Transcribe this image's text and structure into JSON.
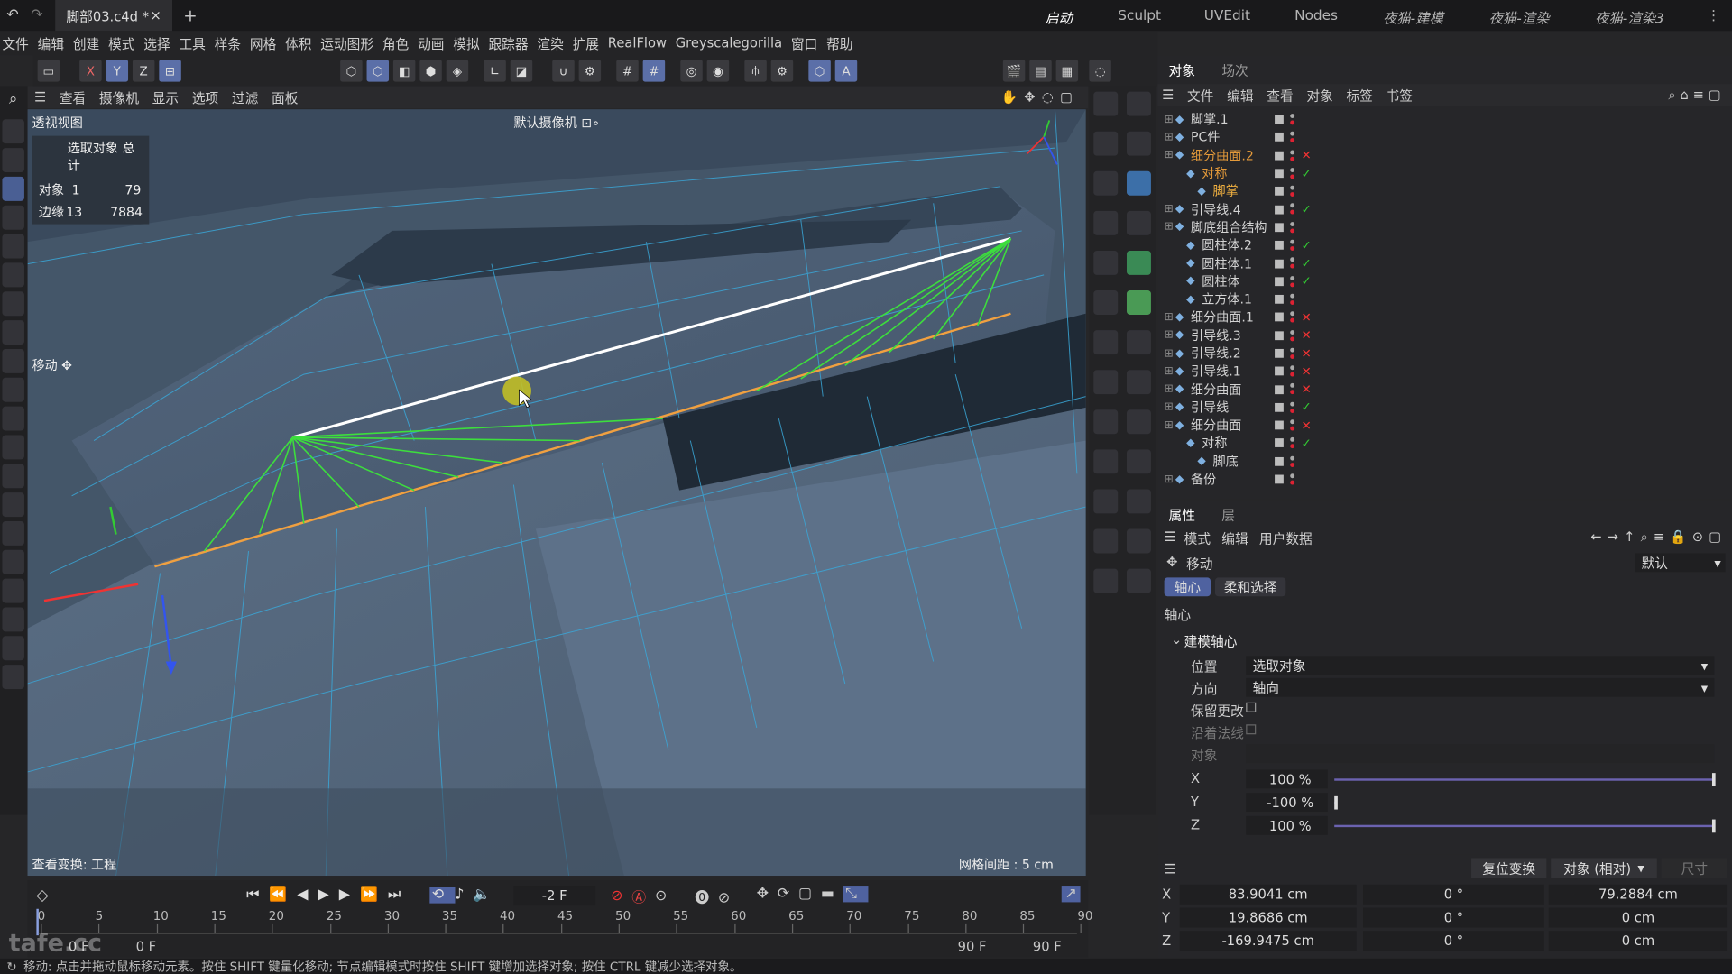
{
  "titlebar": {
    "doc_tab": "脚部03.c4d *",
    "close": "×",
    "add": "+",
    "workspaces": [
      "启动",
      "Sculpt",
      "UVEdit",
      "Nodes",
      "夜猫-建模",
      "夜猫-渲染",
      "夜猫-渲染3"
    ]
  },
  "menubar": [
    "文件",
    "编辑",
    "创建",
    "模式",
    "选择",
    "工具",
    "样条",
    "网格",
    "体积",
    "运动图形",
    "角色",
    "动画",
    "模拟",
    "跟踪器",
    "渲染",
    "扩展",
    "RealFlow",
    "Greyscalegorilla",
    "窗口",
    "帮助"
  ],
  "viewport_menu": [
    "查看",
    "摄像机",
    "显示",
    "选项",
    "过滤",
    "面板"
  ],
  "viewport": {
    "name": "透视视图",
    "camera": "默认摄像机 ⊡∘",
    "stats_header": "选取对象 总计",
    "stats": [
      {
        "label": "对象",
        "sel": "1",
        "total": "79"
      },
      {
        "label": "边缘",
        "sel": "13",
        "total": "7884"
      }
    ],
    "tool": "移动 ✥",
    "view_transform": "查看变换: 工程",
    "grid_spacing": "网格间距 : 5 cm"
  },
  "objpanel": {
    "tabs": [
      "对象",
      "场次"
    ],
    "menu": [
      "文件",
      "编辑",
      "查看",
      "对象",
      "标签",
      "书签"
    ],
    "items": [
      {
        "name": "脚掌.1",
        "indent": 0,
        "color": "#d3d3d3",
        "status": ""
      },
      {
        "name": "PC件",
        "indent": 0,
        "color": "#d3d3d3",
        "status": ""
      },
      {
        "name": "细分曲面.2",
        "indent": 0,
        "color": "#e49a3a",
        "status": "✕"
      },
      {
        "name": "对称",
        "indent": 1,
        "color": "#e49a3a",
        "status": "✓"
      },
      {
        "name": "脚掌",
        "indent": 2,
        "color": "#f0b040",
        "status": ""
      },
      {
        "name": "引导线.4",
        "indent": 0,
        "color": "#d3d3d3",
        "status": "✓"
      },
      {
        "name": "脚底组合结构",
        "indent": 0,
        "color": "#d3d3d3",
        "status": ""
      },
      {
        "name": "圆柱体.2",
        "indent": 1,
        "color": "#d3d3d3",
        "status": "✓"
      },
      {
        "name": "圆柱体.1",
        "indent": 1,
        "color": "#d3d3d3",
        "status": "✓"
      },
      {
        "name": "圆柱体",
        "indent": 1,
        "color": "#d3d3d3",
        "status": "✓"
      },
      {
        "name": "立方体.1",
        "indent": 1,
        "color": "#d3d3d3",
        "status": ""
      },
      {
        "name": "细分曲面.1",
        "indent": 0,
        "color": "#d3d3d3",
        "status": "✕"
      },
      {
        "name": "引导线.3",
        "indent": 0,
        "color": "#d3d3d3",
        "status": "✕"
      },
      {
        "name": "引导线.2",
        "indent": 0,
        "color": "#d3d3d3",
        "status": "✕"
      },
      {
        "name": "引导线.1",
        "indent": 0,
        "color": "#d3d3d3",
        "status": "✕"
      },
      {
        "name": "细分曲面",
        "indent": 0,
        "color": "#d3d3d3",
        "status": "✕"
      },
      {
        "name": "引导线",
        "indent": 0,
        "color": "#d3d3d3",
        "status": "✓"
      },
      {
        "name": "细分曲面",
        "indent": 0,
        "color": "#d3d3d3",
        "status": "✕"
      },
      {
        "name": "对称",
        "indent": 1,
        "color": "#d3d3d3",
        "status": "✓"
      },
      {
        "name": "脚底",
        "indent": 2,
        "color": "#d3d3d3",
        "status": ""
      },
      {
        "name": "备份",
        "indent": 0,
        "color": "#d3d3d3",
        "status": ""
      }
    ]
  },
  "attrpanel": {
    "tabs": [
      "属性",
      "层"
    ],
    "menu": [
      "模式",
      "编辑",
      "用户数据"
    ],
    "tool": "移动",
    "preset": "默认",
    "subtabs": [
      "轴心",
      "柔和选择"
    ],
    "section": "轴心",
    "group": "建模轴心",
    "position_label": "位置",
    "position_value": "选取对象",
    "direction_label": "方向",
    "direction_value": "轴向",
    "keep_changes": "保留更改",
    "along_normal": "沿着法线",
    "object_label": "对象",
    "scale": [
      {
        "axis": "X",
        "value": "100 %",
        "level": 1.0
      },
      {
        "axis": "Y",
        "value": "-100 %",
        "level": 0.0
      },
      {
        "axis": "Z",
        "value": "100 %",
        "level": 1.0
      }
    ]
  },
  "coords": {
    "reset": "复位变换",
    "mode": "对象 (相对)",
    "size": "尺寸",
    "rows": [
      {
        "axis": "X",
        "pos": "83.9041 cm",
        "rot": "0 °",
        "size": "79.2884 cm"
      },
      {
        "axis": "Y",
        "pos": "19.8686 cm",
        "rot": "0 °",
        "size": "0 cm"
      },
      {
        "axis": "Z",
        "pos": "-169.9475 cm",
        "rot": "0 °",
        "size": "0 cm"
      }
    ]
  },
  "timeline": {
    "frame": "-2 F",
    "ticks": [
      "0",
      "5",
      "10",
      "15",
      "20",
      "25",
      "30",
      "35",
      "40",
      "45",
      "50",
      "55",
      "60",
      "65",
      "70",
      "75",
      "80",
      "85",
      "90"
    ],
    "start": "0 F",
    "start2": "0 F",
    "end": "90 F",
    "end2": "90 F"
  },
  "status": "移动: 点击并拖动鼠标移动元素。按住 SHIFT 键量化移动; 节点编辑模式时按住 SHIFT 键增加选择对象; 按住 CTRL 键减少选择对象。",
  "watermark": "tafe.cc"
}
